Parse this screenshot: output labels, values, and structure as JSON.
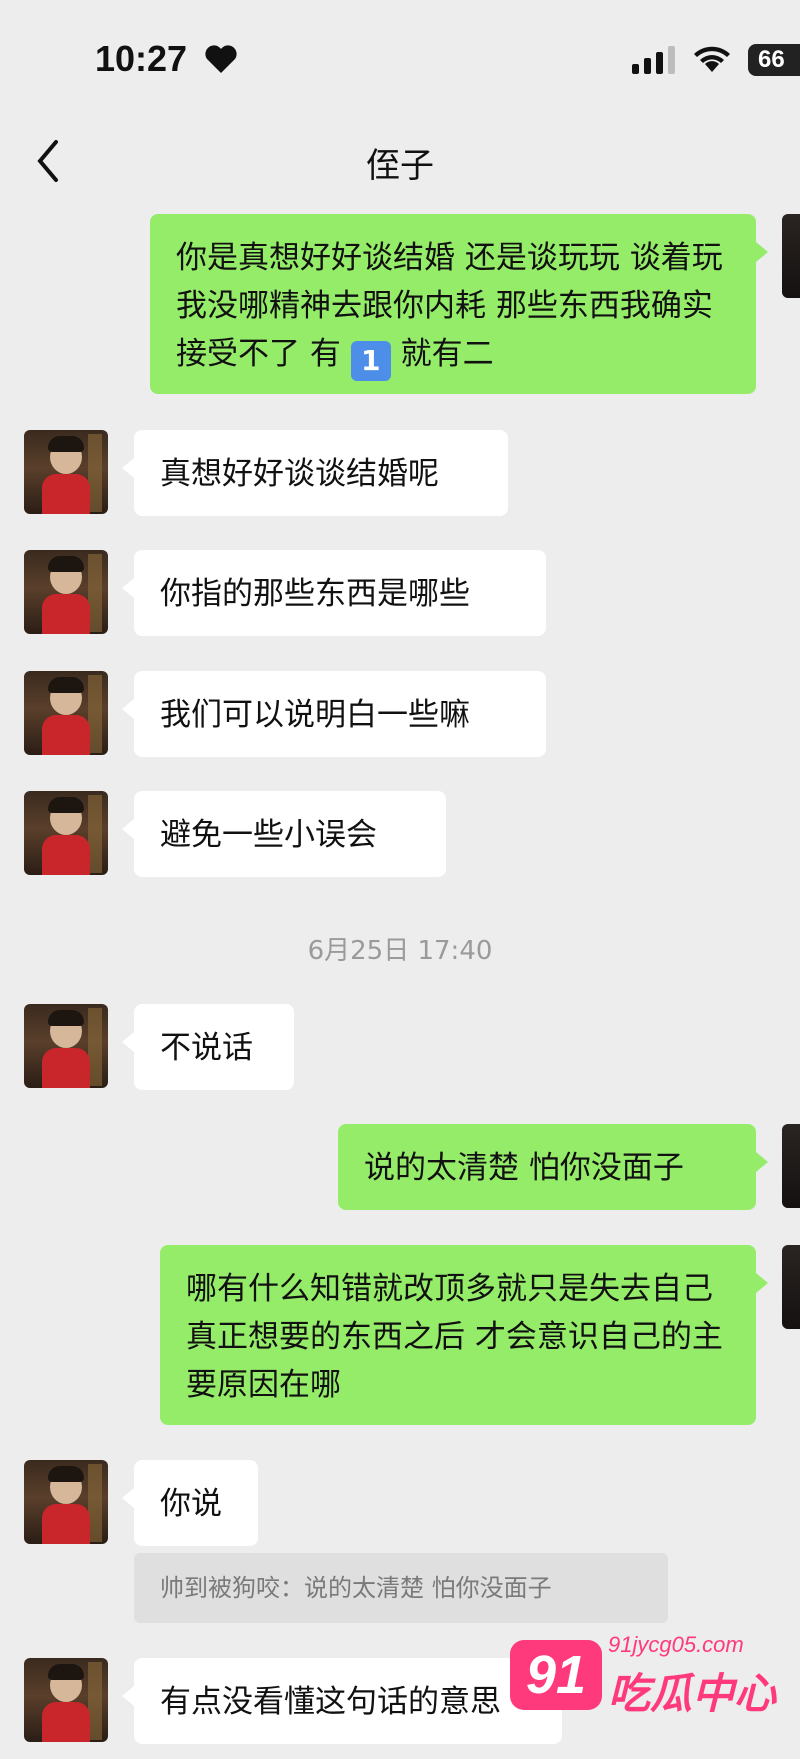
{
  "status": {
    "time": "10:27",
    "battery": "66"
  },
  "header": {
    "title": "侄子"
  },
  "messages": {
    "m1": "你是真想好好谈结婚 还是谈玩玩 谈着玩我没哪精神去跟你内耗 那些东西我确实接受不了 有",
    "m1_emoji": "1",
    "m1_tail": "就有二",
    "m2": "真想好好谈谈结婚呢",
    "m3": "你指的那些东西是哪些",
    "m4": "我们可以说明白一些嘛",
    "m5": "避免一些小误会",
    "timestamp": "6月25日 17:40",
    "m6": "不说话",
    "m7": "说的太清楚 怕你没面子",
    "m8": "哪有什么知错就改顶多就只是失去自己真正想要的东西之后 才会意识自己的主要原因在哪",
    "m9": "你说",
    "quote": "帅到被狗咬：说的太清楚 怕你没面子",
    "m10": "有点没看懂这句话的意思"
  },
  "watermark": {
    "badge": "91",
    "url": "91jycg05.com",
    "name": "吃瓜中心"
  },
  "colors": {
    "outgoing": "#95ec69",
    "incoming": "#ffffff",
    "background": "#ededed",
    "watermark": "#ff3a7c"
  }
}
